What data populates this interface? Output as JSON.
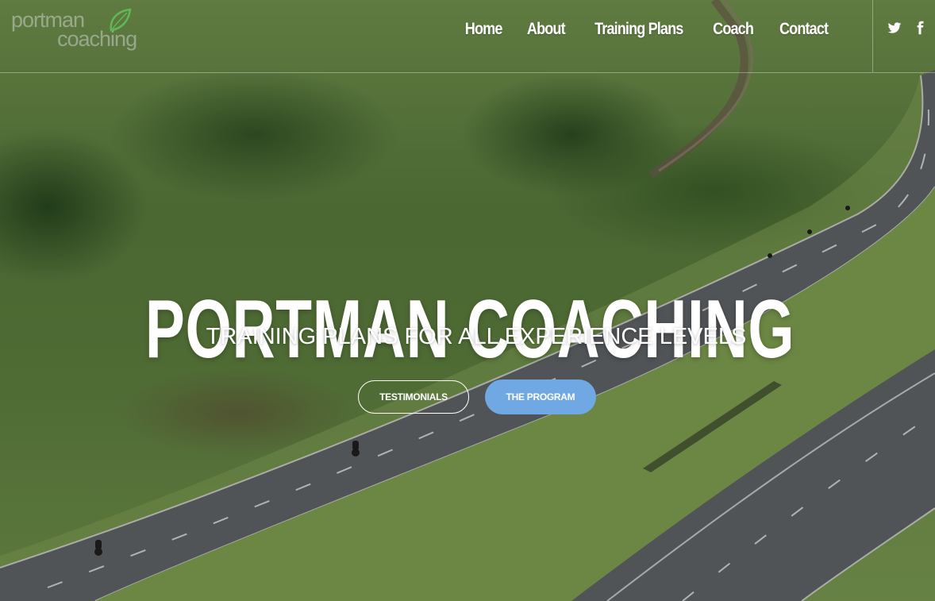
{
  "brand": {
    "logo_line1": "portman",
    "logo_line2": "coaching"
  },
  "nav": {
    "items": [
      {
        "label": "Home"
      },
      {
        "label": "About"
      },
      {
        "label": "Training Plans"
      },
      {
        "label": "Coach"
      },
      {
        "label": "Contact"
      }
    ]
  },
  "social": {
    "icons": [
      "twitter-icon",
      "facebook-icon"
    ]
  },
  "hero": {
    "title": "PORTMAN COACHING",
    "subtitle": "TRAINING PLANS FOR ALL EXPERIENCE LEVELS",
    "buttons": {
      "testimonials": "TESTIMONIALS",
      "program": "THE PROGRAM"
    }
  },
  "colors": {
    "accent": "#6fa8e2",
    "text": "#ffffff"
  }
}
